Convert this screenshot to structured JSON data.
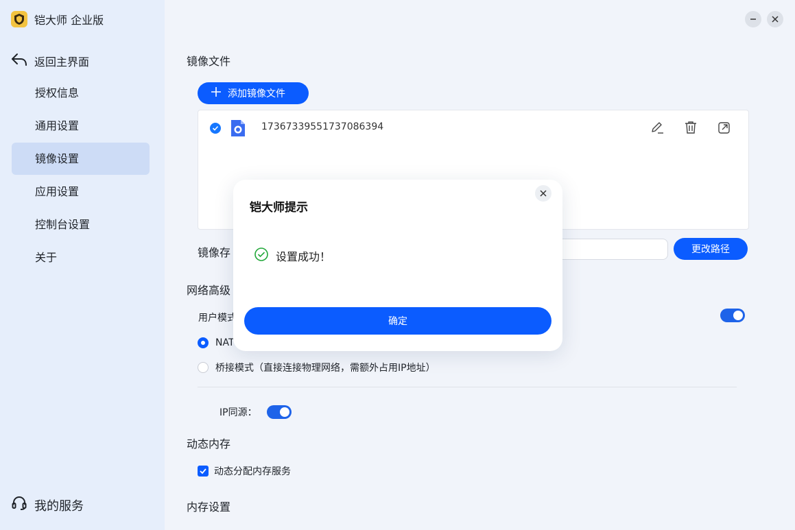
{
  "app": {
    "title": "铠大师 企业版"
  },
  "sidebar": {
    "back_label": "返回主界面",
    "items": [
      {
        "label": "授权信息",
        "active": false
      },
      {
        "label": "通用设置",
        "active": false
      },
      {
        "label": "镜像设置",
        "active": true
      },
      {
        "label": "应用设置",
        "active": false
      },
      {
        "label": "控制台设置",
        "active": false
      },
      {
        "label": "关于",
        "active": false
      }
    ],
    "service_label": "我的服务"
  },
  "main": {
    "image_files_title": "镜像文件",
    "add_button_label": "添加镜像文件",
    "files": [
      {
        "name": "17367339551737086394",
        "selected": true
      }
    ],
    "image_path_label": "镜像存储路径：",
    "image_path_label_visible": "镜像存",
    "image_path_value": "",
    "change_path_label": "更改路径",
    "network_title": "网络高级设置",
    "network_title_visible": "网络高级",
    "user_mode_label": "用户模式",
    "user_mode_label_visible": "用户模式",
    "nat_label": "NAT模式",
    "nat_label_visible": "NAT",
    "bridge_label": "桥接模式（直接连接物理网络，需额外占用IP地址）",
    "ip_same_label": "IP同源：",
    "dynamic_memory_title": "动态内存",
    "dynamic_memory_checkbox_label": "动态分配内存服务",
    "memory_settings_title": "内存设置"
  },
  "dialog": {
    "title": "铠大师提示",
    "message": "设置成功！",
    "ok_label": "确定"
  },
  "colors": {
    "accent": "#0b5cff",
    "sidebar_bg": "#e6eefb",
    "active_item_bg": "#cddcf6",
    "success": "#22a83a"
  }
}
